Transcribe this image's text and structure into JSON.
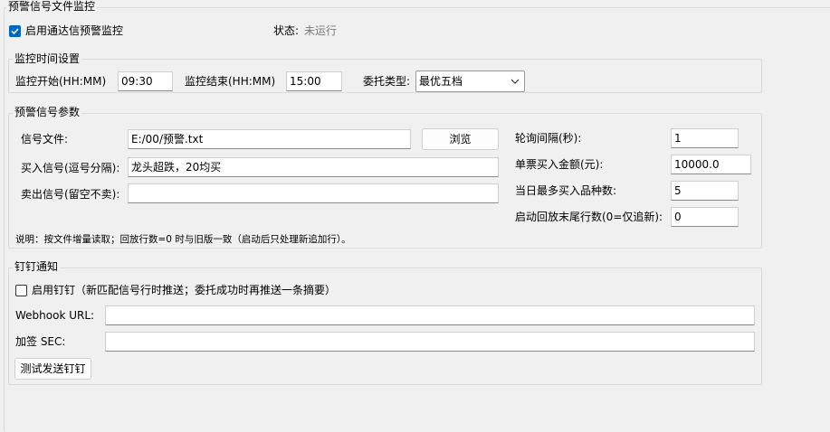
{
  "main_group": {
    "title": "预警信号文件监控"
  },
  "enable_monitor": {
    "label": "启用通达信预警监控",
    "checked": true
  },
  "status": {
    "label": "状态:",
    "value": "未运行"
  },
  "time_group": {
    "title": "监控时间设置",
    "start_label": "监控开始(HH:MM)",
    "start_value": "09:30",
    "end_label": "监控结束(HH:MM)",
    "end_value": "15:00",
    "order_type_label": "委托类型:",
    "order_type_value": "最优五档"
  },
  "signal_group": {
    "title": "预警信号参数",
    "file_label": "信号文件:",
    "file_value": "E:/00/预警.txt",
    "browse_label": "浏览",
    "buy_label": "买入信号(逗号分隔):",
    "buy_value": "龙头超跌，20均买",
    "sell_label": "卖出信号(留空不卖):",
    "sell_value": "",
    "poll_label": "轮询间隔(秒):",
    "poll_value": "1",
    "amount_label": "单票买入金额(元):",
    "amount_value": "10000.0",
    "max_label": "当日最多买入品种数:",
    "max_value": "5",
    "replay_label": "启动回放末尾行数(0=仅追新):",
    "replay_value": "0",
    "note": "说明：按文件增量读取；回放行数=0 时与旧版一致（启动后只处理新追加行）。"
  },
  "ding_group": {
    "title": "钉钉通知",
    "enable_label": "启用钉钉（新匹配信号行时推送；委托成功时再推送一条摘要）",
    "enable_checked": false,
    "webhook_label": "Webhook URL:",
    "webhook_value": "",
    "sec_label": "加签 SEC:",
    "sec_value": "",
    "test_label": "测试发送钉钉"
  }
}
